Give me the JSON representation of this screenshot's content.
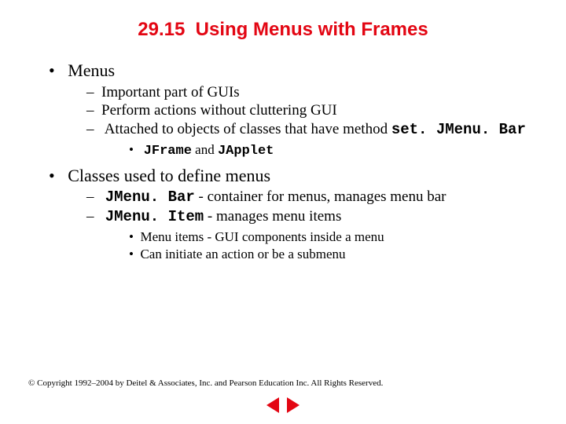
{
  "title": "29.15  Using Menus with Frames",
  "bullets": {
    "b1": "Menus",
    "b1_1": "Important part of GUIs",
    "b1_2": "Perform actions without cluttering GUI",
    "b1_3_a": "Attached to objects of classes that have method ",
    "b1_3_code": "set. JMenu. Bar",
    "b1_3_1_a": "JFrame",
    "b1_3_1_b": " and ",
    "b1_3_1_c": "JApplet",
    "b2": "Classes used to define menus",
    "b2_1_code": "JMenu. Bar",
    "b2_1_rest": " - container for menus, manages menu bar",
    "b2_2_code": "JMenu. Item",
    "b2_2_rest": " - manages menu items",
    "b2_2_1": "Menu items - GUI components inside a menu",
    "b2_2_2": "Can initiate an action or be a submenu"
  },
  "copyright": "© Copyright 1992–2004 by Deitel & Associates, Inc. and Pearson Education Inc. All Rights Reserved.",
  "nav": {
    "prev": "previous-slide",
    "next": "next-slide"
  }
}
